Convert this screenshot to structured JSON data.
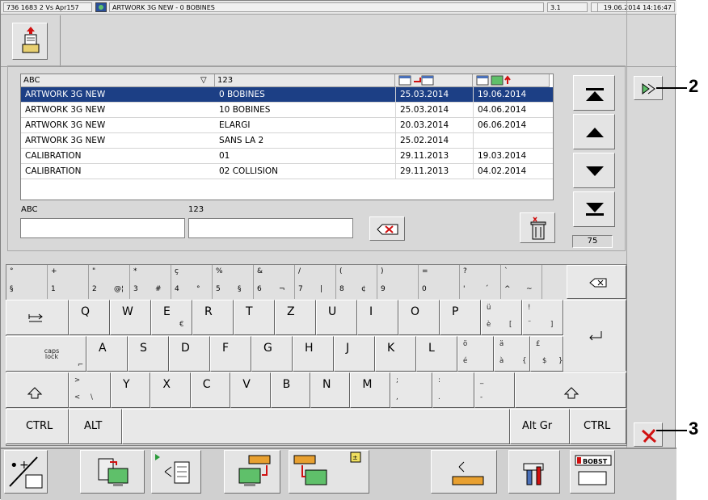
{
  "titlebar": {
    "machine": "736 1683 2 Vs Apr157",
    "job": "ARTWORK 3G NEW - 0 BOBINES",
    "page": "3.1",
    "datetime": "19.06.2014 14:16:47"
  },
  "list": {
    "headers": [
      "ABC",
      "123",
      "",
      ""
    ],
    "rows": [
      [
        "ARTWORK 3G NEW",
        "0 BOBINES",
        "25.03.2014",
        "19.06.2014"
      ],
      [
        "ARTWORK 3G NEW",
        "10 BOBINES",
        "25.03.2014",
        "04.06.2014"
      ],
      [
        "ARTWORK 3G NEW",
        "ELARGI",
        "20.03.2014",
        "06.06.2014"
      ],
      [
        "ARTWORK 3G NEW",
        "SANS LA 2",
        "25.02.2014",
        ""
      ],
      [
        "CALIBRATION",
        "01",
        "29.11.2013",
        "19.03.2014"
      ],
      [
        "CALIBRATION",
        "02 COLLISION",
        "29.11.2013",
        "04.02.2014"
      ]
    ],
    "selected_index": 0
  },
  "filters": {
    "abc_label": "ABC",
    "num_label": "123",
    "abc_value": "",
    "num_value": ""
  },
  "counter": "75",
  "keyboard": {
    "row1": [
      {
        "top": "°",
        "bot": "§"
      },
      {
        "top": "+",
        "bot": "1"
      },
      {
        "top": "\"",
        "bot": "2",
        "alt": "@",
        "altt": "¦"
      },
      {
        "top": "*",
        "bot": "3",
        "alt": "#"
      },
      {
        "top": "ç",
        "bot": "4",
        "alt": "°"
      },
      {
        "top": "%",
        "bot": "5",
        "alt": "§"
      },
      {
        "top": "&",
        "bot": "6",
        "alt": "¬"
      },
      {
        "top": "/",
        "bot": "7",
        "alt": "|"
      },
      {
        "top": "(",
        "bot": "8",
        "alt": "¢"
      },
      {
        "top": ")",
        "bot": "9"
      },
      {
        "top": "=",
        "bot": "0"
      },
      {
        "top": "?",
        "bot": "'",
        "alt": "´"
      },
      {
        "top": "`",
        "bot": "^",
        "alt": "~"
      }
    ],
    "row2": [
      "Q",
      "W",
      "E",
      "R",
      "T",
      "Z",
      "U",
      "I",
      "O",
      "P"
    ],
    "row2_extra": {
      "e_alt": "€",
      "u_top": "ü",
      "u_bot": "è",
      "u_alt": "[",
      "ex_top": "!",
      "ex_bot": "¨",
      "ex_alt": "]"
    },
    "row3": [
      "A",
      "S",
      "D",
      "F",
      "G",
      "H",
      "J",
      "K",
      "L"
    ],
    "row3_extra": {
      "o_top": "ö",
      "o_bot": "é",
      "a_top": "ä",
      "a_bot": "à",
      "a_alt": "{",
      "p_top": "£",
      "p_bot": "$",
      "p_alt": "}"
    },
    "row4": [
      "Y",
      "X",
      "C",
      "V",
      "B",
      "N",
      "M"
    ],
    "row4_extra": {
      "gt": ">",
      "lt": "<",
      "bs": "\\",
      "semi": ";",
      "comma": ",",
      "colon": ":",
      "dot": ".",
      "under": "_",
      "dash": "-"
    },
    "caps_label": "caps lock",
    "ctrl_left": "CTRL",
    "alt": "ALT",
    "altgr": "Alt Gr",
    "ctrl_right": "CTRL"
  },
  "callouts": [
    "2",
    "3"
  ],
  "colors": {
    "selection": "#1c3f85",
    "panel": "#d8d8d8",
    "delete_red": "#d01010"
  }
}
